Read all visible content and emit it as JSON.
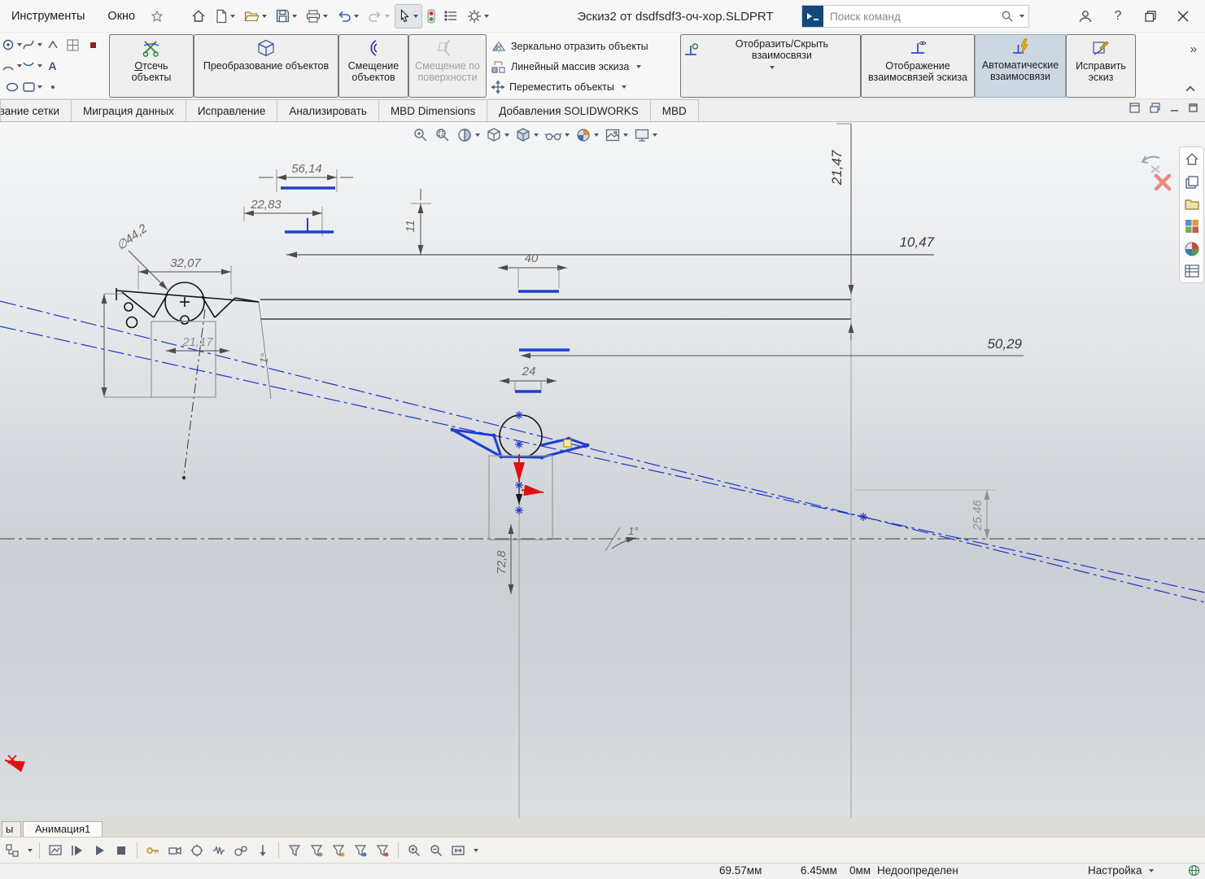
{
  "window": {
    "menus": [
      {
        "label": "Инструменты"
      },
      {
        "label": "Окно"
      }
    ],
    "doc_title": "Эскиз2 от dsdfsdf3-оч-хор.SLDPRT",
    "search_placeholder": "Поиск команд",
    "help_glyph": "?"
  },
  "ribbon": {
    "overflow_glyph": "»",
    "text_tool_glyph": "A",
    "buttons": {
      "trim": "Отсечь объекты",
      "convert": "Преобразование объектов",
      "offset": "Смещение объектов",
      "offset_surface": "Смещение по поверхности",
      "mirror": "Зеркально отразить объекты",
      "linear_pattern": "Линейный массив эскиза",
      "move": "Переместить объекты",
      "show_hide_relations": "Отобразить/Скрыть взаимосвязи",
      "display_relations": "Отображение взаимосвязей эскиза",
      "auto_relations": "Автоматические взаимосвязи",
      "repair_sketch": "Исправить эскиз"
    }
  },
  "tabs": [
    {
      "label": "вание сетки"
    },
    {
      "label": "Миграция данных"
    },
    {
      "label": "Исправление"
    },
    {
      "label": "Анализировать"
    },
    {
      "label": "MBD Dimensions"
    },
    {
      "label": "Добавления SOLIDWORKS"
    },
    {
      "label": "MBD"
    }
  ],
  "sketch": {
    "dims": {
      "w5614": "56,14",
      "w2283": "22,83",
      "w3207": "32,07",
      "dia442": "∅44,2",
      "h11": "11",
      "w40": "40",
      "w1047": "10,47",
      "h2147": "21,47",
      "w5029": "50,29",
      "w24": "24",
      "h728": "72,8",
      "h2546": "25,46",
      "w2117": "21,17",
      "ang_right": "1°",
      "ang_left": "1°"
    }
  },
  "motion": {
    "partial_tab": "ы",
    "active_tab": "Анимация1"
  },
  "statusbar": {
    "coord_x": "69.57мм",
    "coord_y": "6.45мм",
    "coord_z": "0мм",
    "state": "Недоопределен",
    "settings": "Настройка"
  }
}
